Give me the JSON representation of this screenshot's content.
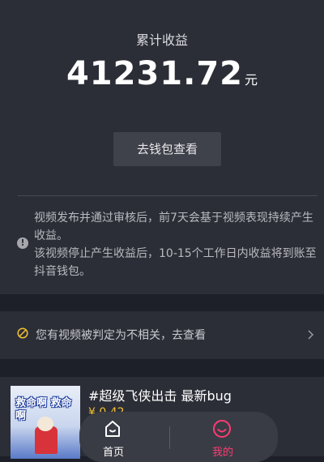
{
  "earnings": {
    "label": "累计收益",
    "amount": "41231.72",
    "unit": "元",
    "wallet_button": "去钱包查看"
  },
  "notice": {
    "icon": "exclamation-icon",
    "line1": "视频发布并通过审核后，前7天会基于视频表现持续产生收益。",
    "line2": "该视频停止产生收益后，10-15个工作日内收益将到账至抖音钱包。"
  },
  "relevance": {
    "icon": "prohibited-icon",
    "text": "您有视频被判定为不相关，去查看",
    "chevron": "chevron-right-icon"
  },
  "video": {
    "thumbnail_text": "救命啊 救命啊",
    "title": "#超级飞侠出击 最新bug",
    "income": "¥ 0.42"
  },
  "tabbar": {
    "home_label": "首页",
    "me_label": "我的"
  },
  "colors": {
    "background": "#1e2029",
    "card": "#2c2e37",
    "accent": "#ff3b73",
    "warning": "#f2c230"
  }
}
